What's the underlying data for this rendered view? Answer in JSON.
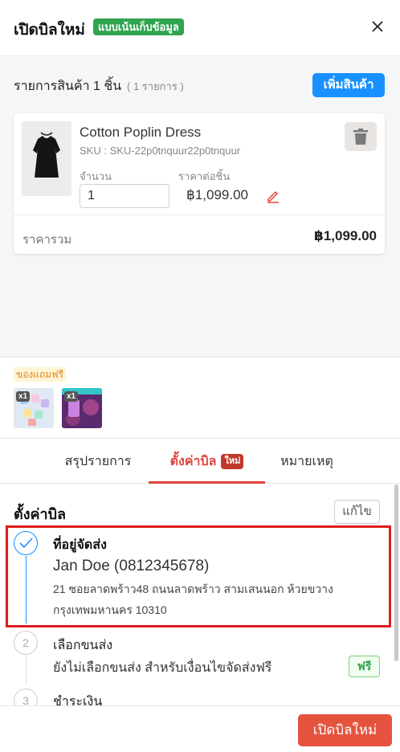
{
  "header": {
    "title": "เปิดบิลใหม่",
    "mode_badge": "แบบเน้นเก็บข้อมูล",
    "close_icon": "close-icon"
  },
  "items": {
    "heading": "รายการสินค้า 1 ชิ้น",
    "sub_count": "( 1 รายการ )",
    "add_button": "เพิ่มสินค้า",
    "product": {
      "name": "Cotton Poplin Dress",
      "sku": "SKU : SKU-22p0tnquur22p0tnquur",
      "qty_label": "จำนวน",
      "qty_value": "1",
      "unit_price_label": "ราคาต่อชิ้น",
      "unit_price": "฿1,099.00",
      "total_label": "ราคารวม",
      "total_value": "฿1,099.00"
    }
  },
  "gifts": {
    "label": "ของแถมฟรี",
    "items": [
      {
        "qty": "x1"
      },
      {
        "qty": "x1"
      }
    ]
  },
  "tabs": [
    {
      "label": "สรุปรายการ"
    },
    {
      "label": "ตั้งค่าบิล",
      "badge": "ใหม่",
      "active": true
    },
    {
      "label": "หมายเหตุ"
    }
  ],
  "settings": {
    "title": "ตั้งค่าบิล",
    "edit_button": "แก้ไข",
    "steps": [
      {
        "number": "1",
        "title": "ที่อยู่จัดส่ง",
        "name_phone": "Jan Doe (0812345678)",
        "address_line1": "21 ซอยลาดพร้าว48 ถนนลาดพร้าว สามเสนนอก ห้วยขวาง",
        "address_line2": "กรุงเทพมหานคร 10310"
      },
      {
        "number": "2",
        "title": "เลือกขนส่ง",
        "detail": "ยังไม่เลือกขนส่ง สำหรับเงื่อนไขจัดส่งฟรี",
        "badge": "ฟรี"
      },
      {
        "number": "3",
        "title": "ชำระเงิน"
      }
    ]
  },
  "footer": {
    "create_button": "เปิดบิลใหม่"
  },
  "colors": {
    "primary_blue": "#1890ff",
    "accent_red": "#e0433d",
    "button_red": "#e5533f",
    "badge_green": "#2ea44f",
    "highlight_red": "#e01b1b"
  }
}
